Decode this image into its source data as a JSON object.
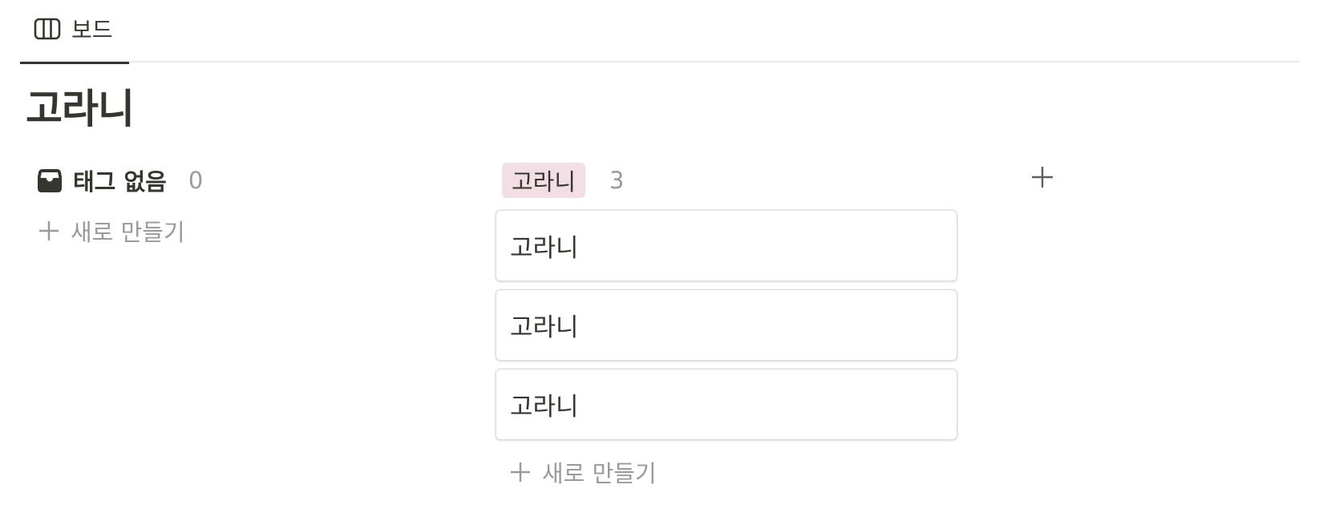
{
  "tabs": [
    {
      "label": "보드",
      "icon": "board-columns-icon",
      "active": true
    }
  ],
  "page": {
    "title": "고라니"
  },
  "columns": {
    "no_tag": {
      "icon": "inbox-icon",
      "label": "태그 없음",
      "count": "0",
      "new_label": "새로 만들기"
    },
    "tag": {
      "label": "고라니",
      "tag_color": "#f1dfe5",
      "count": "3",
      "cards": [
        {
          "title": "고라니"
        },
        {
          "title": "고라니"
        },
        {
          "title": "고라니"
        }
      ],
      "new_label": "새로 만들기"
    }
  },
  "add_group": {
    "icon": "plus-icon"
  },
  "colors": {
    "text": "#37352f",
    "muted": "#9b9a97",
    "divider": "#e9e9e7"
  }
}
